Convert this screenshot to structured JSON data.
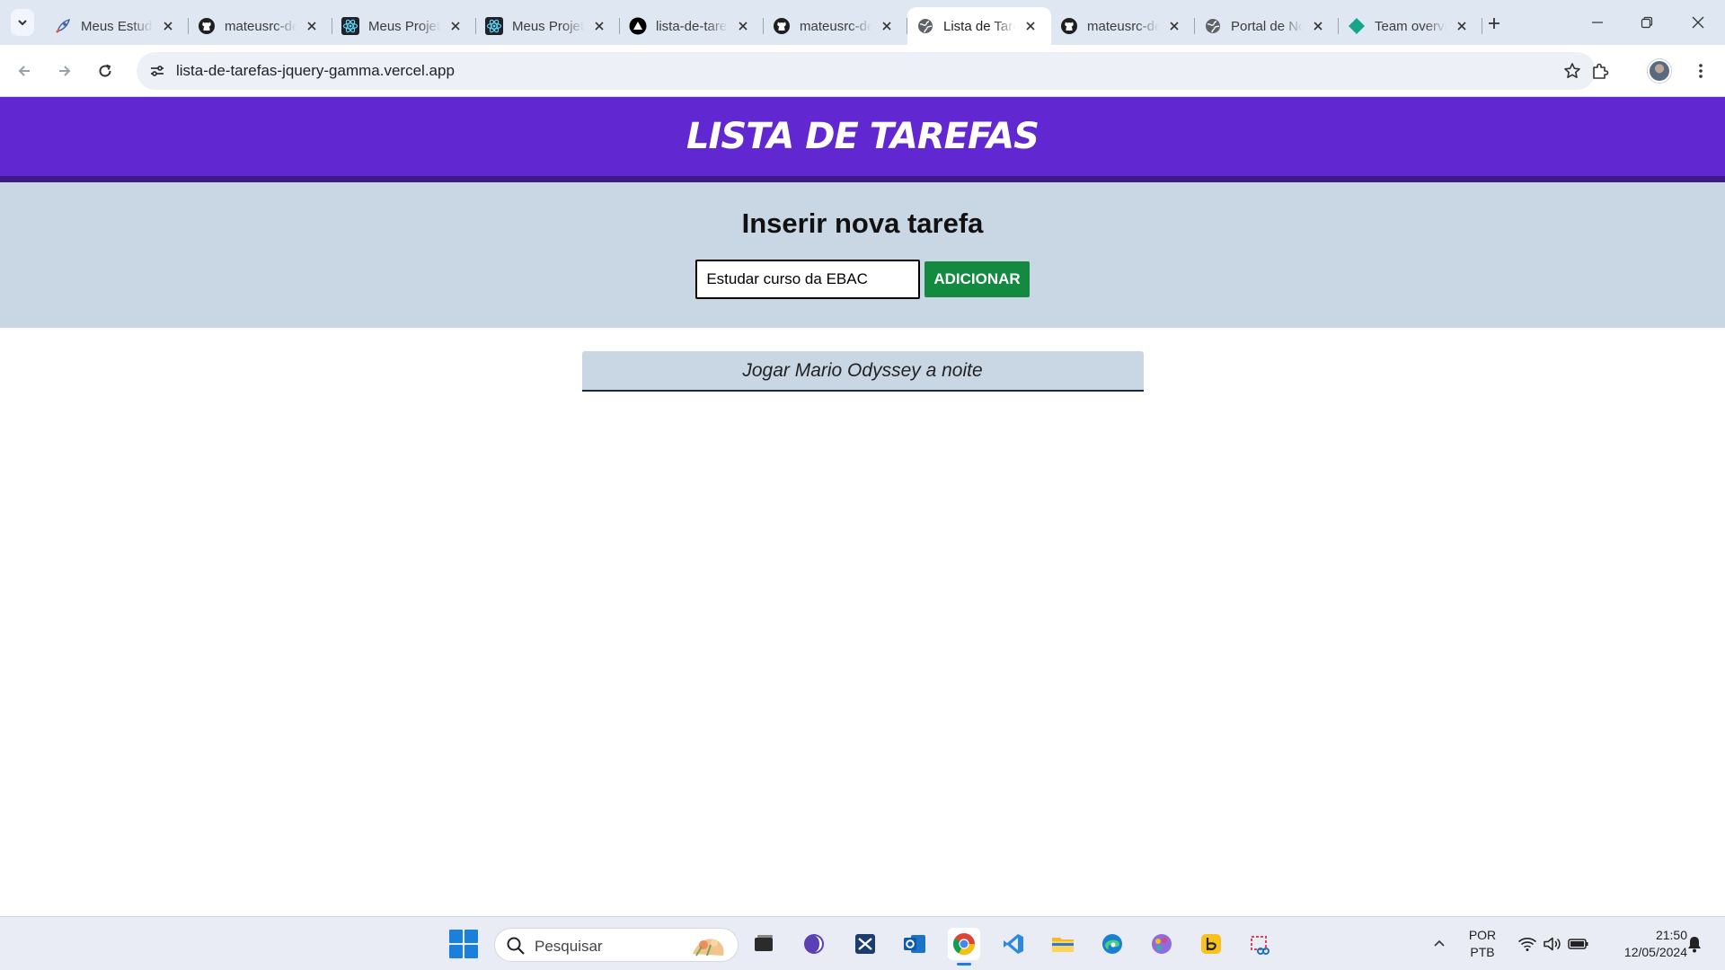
{
  "browser": {
    "tabs": [
      {
        "title": "Meus Estudos",
        "icon": "rocket-icon"
      },
      {
        "title": "mateusrc-dev",
        "icon": "github-icon"
      },
      {
        "title": "Meus Projetos",
        "icon": "react-icon"
      },
      {
        "title": "Meus Projetos",
        "icon": "react-icon"
      },
      {
        "title": "lista-de-tarefas",
        "icon": "vercel-icon"
      },
      {
        "title": "mateusrc-dev",
        "icon": "github-icon"
      },
      {
        "title": "Lista de Tarefas",
        "icon": "globe-icon",
        "active": true
      },
      {
        "title": "mateusrc-dev",
        "icon": "github-icon"
      },
      {
        "title": "Portal de Notícias",
        "icon": "globe-icon"
      },
      {
        "title": "Team overview",
        "icon": "diamond-icon"
      }
    ],
    "url": "lista-de-tarefas-jquery-gamma.vercel.app"
  },
  "page": {
    "header_title": "LISTA DE TAREFAS",
    "form_title": "Inserir nova tarefa",
    "input_value": "Estudar curso da EBAC",
    "add_button": "ADICIONAR",
    "tasks": [
      "Jogar Mario Odyssey a noite"
    ]
  },
  "taskbar": {
    "search_placeholder": "Pesquisar",
    "language": "POR",
    "layout": "PTB",
    "time": "21:50",
    "date": "12/05/2024"
  },
  "colors": {
    "header_bg": "#6127d0",
    "header_border": "#3d1a86",
    "form_bg": "#c9d6e4",
    "button_green": "#138a3f"
  }
}
